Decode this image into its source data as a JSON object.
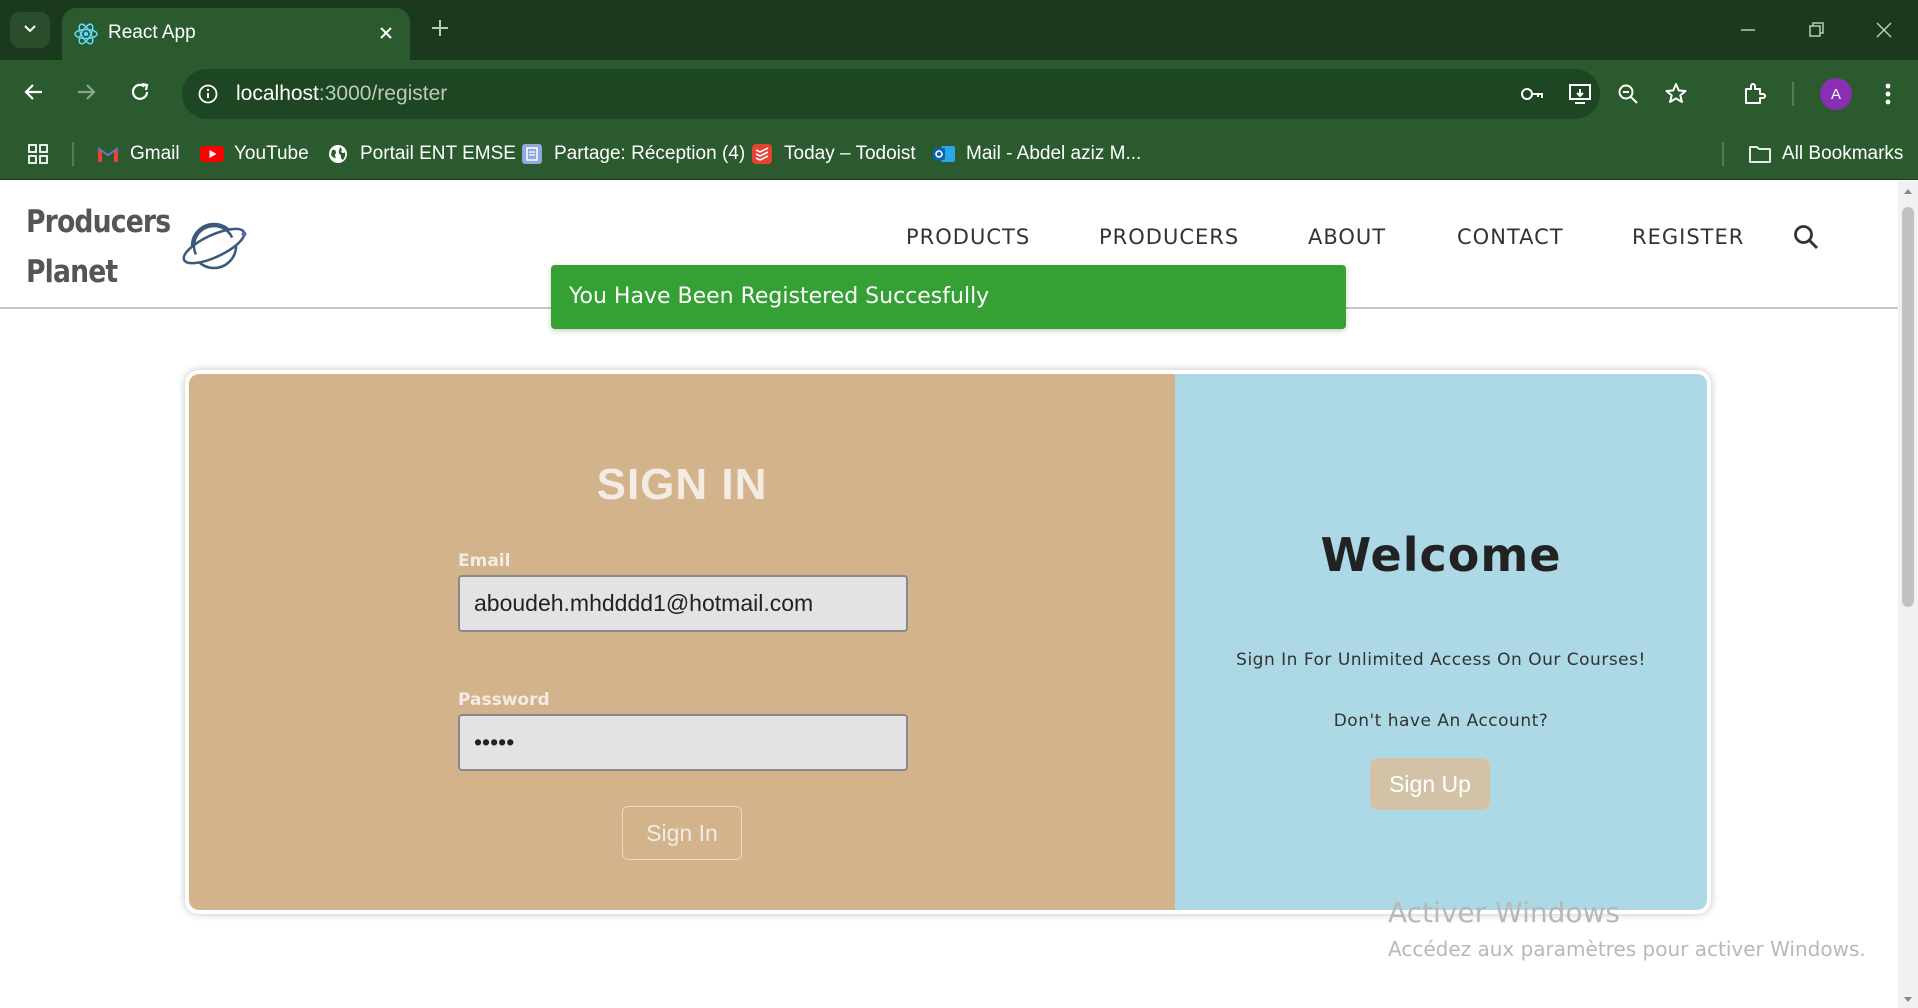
{
  "browser": {
    "tab_title": "React App",
    "url_host": "localhost",
    "url_path": ":3000/register",
    "profile_initial": "A",
    "bookmarks": [
      {
        "label": "Gmail",
        "icon": "gmail-icon"
      },
      {
        "label": "YouTube",
        "icon": "youtube-icon"
      },
      {
        "label": "Portail ENT EMSE",
        "icon": "globe-icon"
      },
      {
        "label": "Partage: Réception (4)",
        "icon": "partage-icon"
      },
      {
        "label": "Today – Todoist",
        "icon": "todoist-icon"
      },
      {
        "label": "Mail - Abdel aziz M...",
        "icon": "outlook-icon"
      }
    ],
    "all_bookmarks_label": "All Bookmarks",
    "colors": {
      "frame": "#1b3a1d",
      "toolbar": "#2a5a2e"
    }
  },
  "site": {
    "logo_line1": "Producers",
    "logo_line2": "Planet",
    "nav": [
      "PRODUCTS",
      "PRODUCERS",
      "ABOUT",
      "CONTACT",
      "REGISTER"
    ]
  },
  "toast": {
    "message": "You Have Been Registered Succesfully",
    "color": "#35a034"
  },
  "signin": {
    "title": "SIGN IN",
    "email_label": "Email",
    "email_value": "aboudeh.mhdddd1@hotmail.com",
    "password_label": "Password",
    "password_value": "•••••",
    "button_label": "Sign In",
    "panel_color": "#d2b38c"
  },
  "welcome": {
    "title": "Welcome",
    "subtitle": "Sign In For Unlimited Access On Our Courses!",
    "question": "Don't have An Account?",
    "button_label": "Sign Up",
    "panel_color": "#add8e6"
  },
  "watermark": {
    "title": "Activer Windows",
    "subtitle": "Accédez aux paramètres pour activer Windows."
  }
}
